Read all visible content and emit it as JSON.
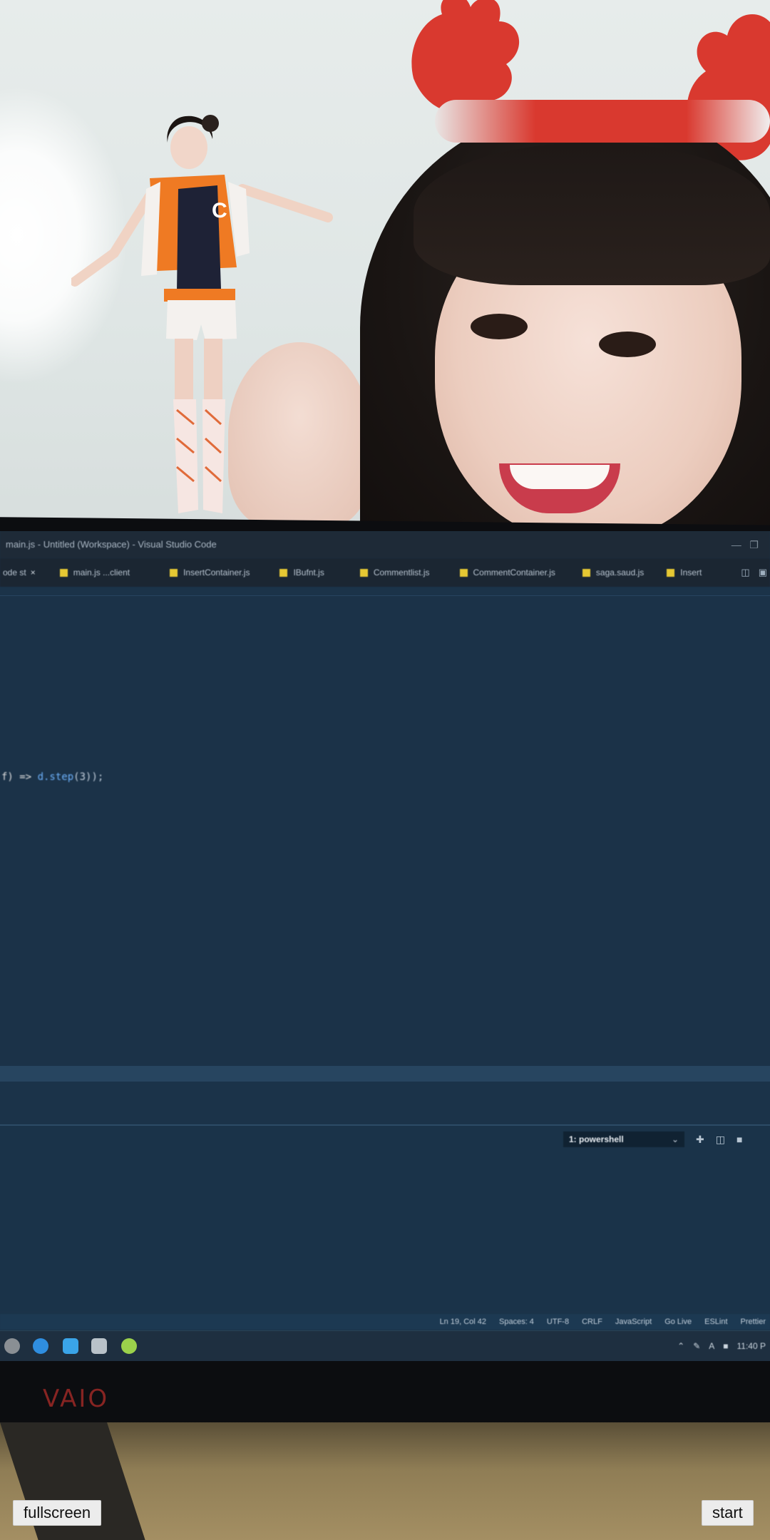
{
  "vscode": {
    "window_title": "main.js - Untitled (Workspace) - Visual Studio Code",
    "tabs": [
      {
        "label": "ode st",
        "type": "plain"
      },
      {
        "label": "main.js ...client",
        "type": "js"
      },
      {
        "label": "InsertContainer.js",
        "type": "js"
      },
      {
        "label": "IBufnt.js",
        "type": "js"
      },
      {
        "label": "Commentlist.js",
        "type": "js"
      },
      {
        "label": "CommentContainer.js",
        "type": "js"
      },
      {
        "label": "saga.saud.js",
        "type": "js"
      },
      {
        "label": "Insert",
        "type": "js"
      }
    ],
    "code_line": {
      "prefix": "f) => ",
      "call": "d.step",
      "suffix": "(3));"
    },
    "terminal_select": "1: powershell",
    "status_items": [
      "Ln 19, Col 42",
      "Spaces: 4",
      "UTF-8",
      "CRLF",
      "JavaScript",
      "Go Live",
      "ESLint",
      "Prettier"
    ],
    "tray_clock": "11:40 P"
  },
  "monitor_brand": "VAIO",
  "overlay": {
    "fullscreen_label": "fullscreen",
    "start_label": "start"
  },
  "colors": {
    "editor_bg": "#1b3248",
    "js_icon": "#e6c833",
    "headband_red": "#d9392f"
  }
}
